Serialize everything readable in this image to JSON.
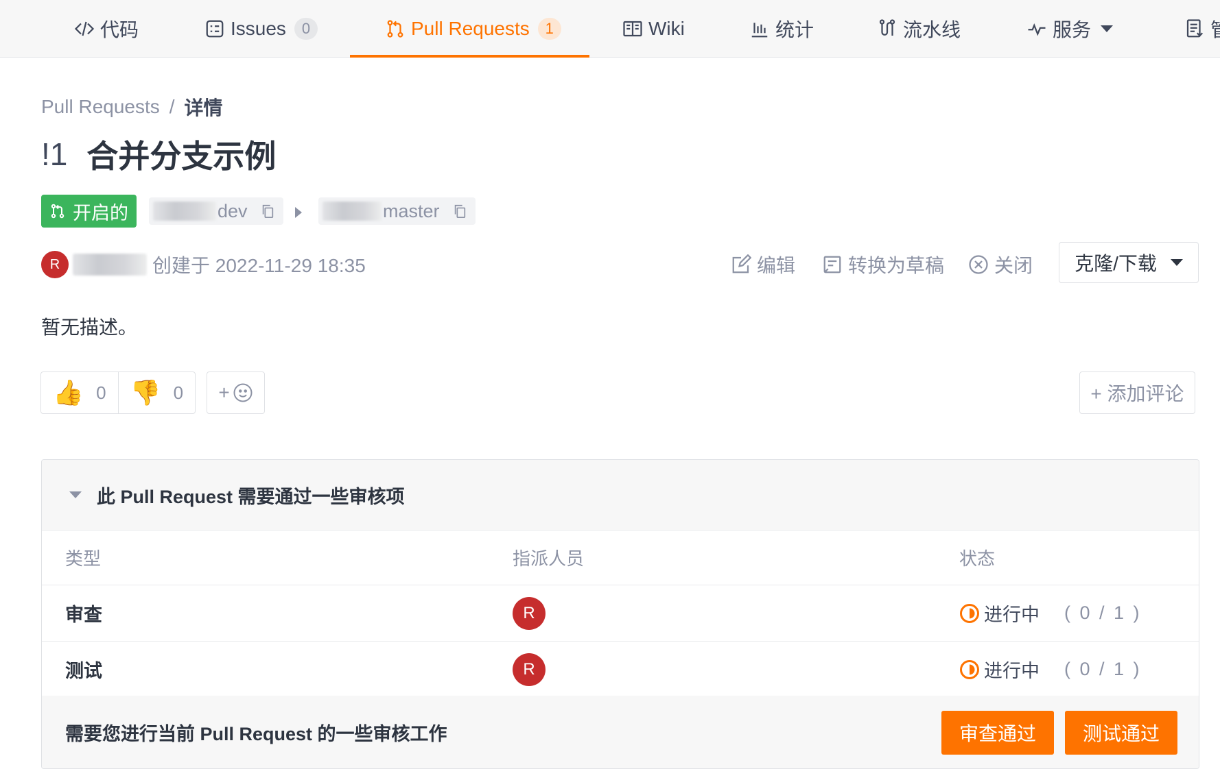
{
  "nav": {
    "tabs": [
      {
        "label": "代码",
        "icon": "code-icon"
      },
      {
        "label": "Issues",
        "icon": "issues-icon",
        "count": "0"
      },
      {
        "label": "Pull Requests",
        "icon": "pull-request-icon",
        "count": "1",
        "active": true
      },
      {
        "label": "Wiki",
        "icon": "book-icon"
      },
      {
        "label": "统计",
        "icon": "bar-chart-icon"
      },
      {
        "label": "流水线",
        "icon": "pipeline-icon"
      },
      {
        "label": "服务",
        "icon": "pulse-icon"
      },
      {
        "label": "管",
        "icon": "document-icon"
      }
    ]
  },
  "breadcrumb": {
    "parent": "Pull Requests",
    "separator": "/",
    "current": "详情"
  },
  "pr": {
    "number": "!1",
    "title": "合并分支示例",
    "state": "开启的",
    "source_branch": "dev",
    "target_branch": "master",
    "created_text": "创建于 2022-11-29 18:35",
    "author_initial": "R",
    "description": "暂无描述。"
  },
  "actions": {
    "edit": "编辑",
    "convert_draft": "转换为草稿",
    "close": "关闭",
    "clone": "克隆/下载"
  },
  "reactions": {
    "thumbs_up": "0",
    "thumbs_down": "0",
    "add": "+",
    "add_comment": "+ 添加评论"
  },
  "review": {
    "title": "此 Pull Request 需要通过一些审核项",
    "columns": [
      "类型",
      "指派人员",
      "状态"
    ],
    "rows": [
      {
        "type": "审查",
        "assignee": "R",
        "status": "进行中",
        "progress": "( 0 / 1 )"
      },
      {
        "type": "测试",
        "assignee": "R",
        "status": "进行中",
        "progress": "( 0 / 1 )"
      }
    ],
    "footer_text": "需要您进行当前 Pull Request 的一些审核工作",
    "approve_review": "审查通过",
    "approve_test": "测试通过"
  },
  "colors": {
    "accent": "#fe7300",
    "open_green": "#3bb55c",
    "avatar_red": "#c62d2d"
  }
}
